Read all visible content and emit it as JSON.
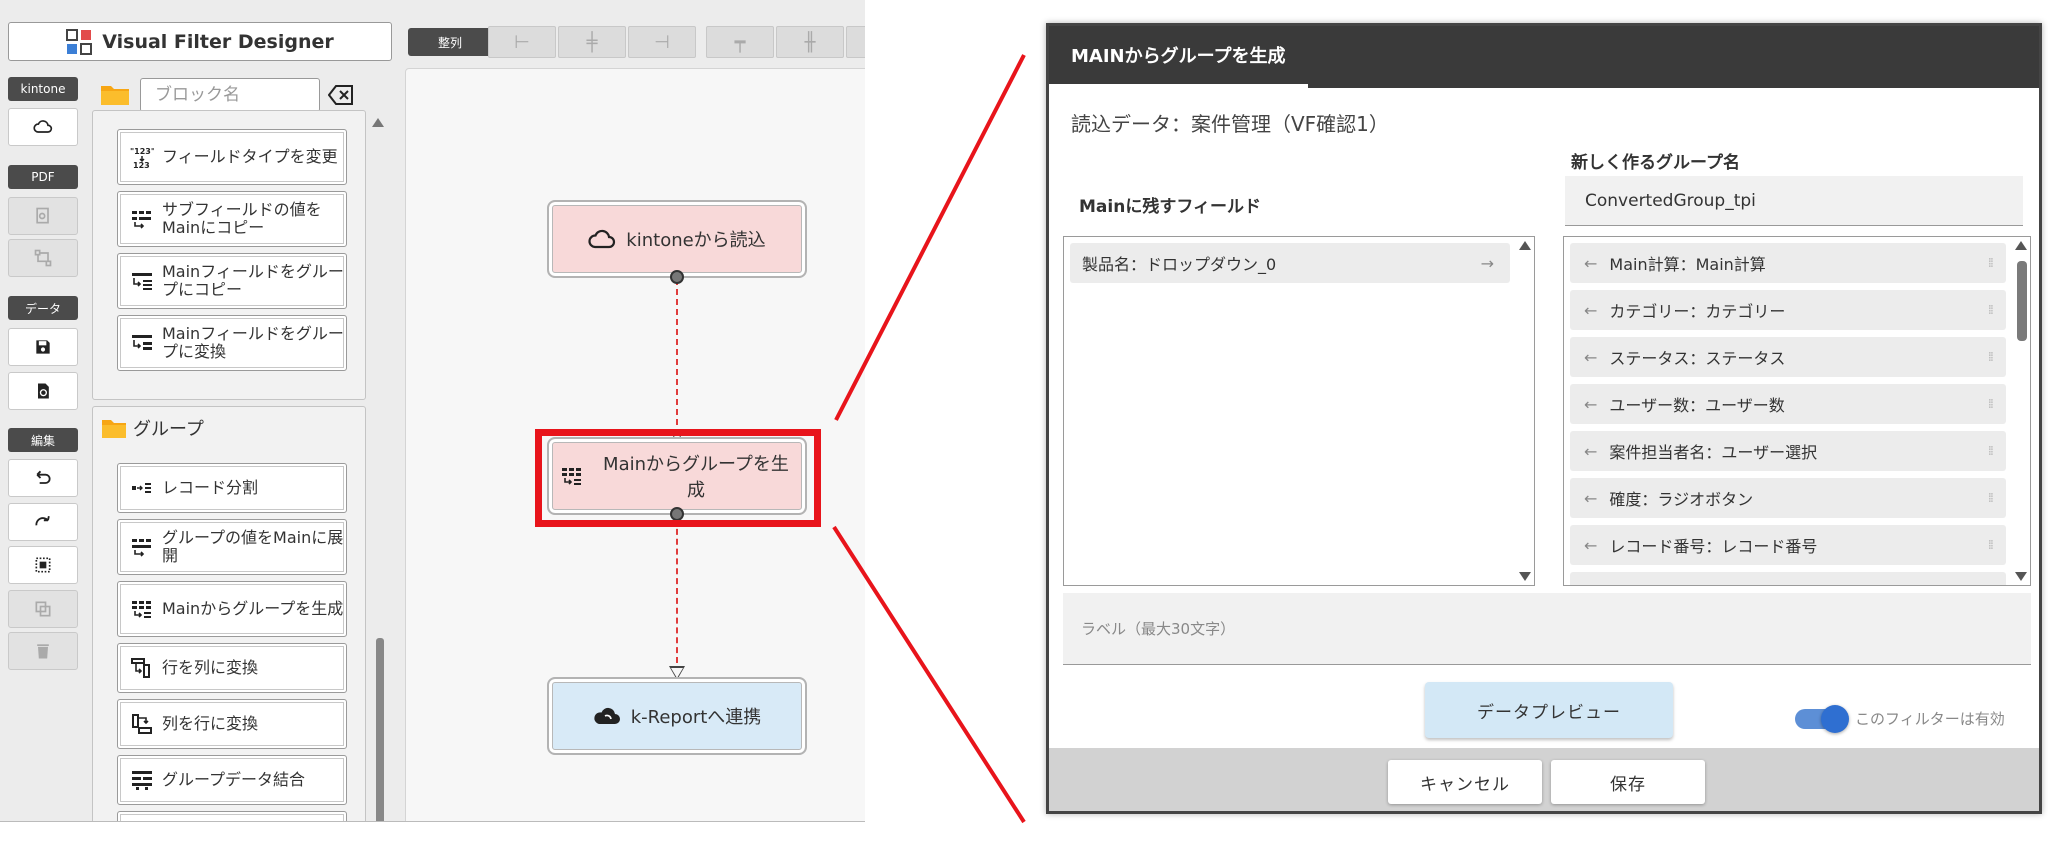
{
  "app": {
    "title": "Visual Filter Designer",
    "align_label": "整列",
    "search_placeholder": "ブロック名"
  },
  "sidebar": {
    "kintone_label": "kintone",
    "pdf_label": "PDF",
    "data_label": "データ",
    "edit_label": "編集"
  },
  "palette": {
    "blocks_top": [
      "フィールドタイプを変更",
      "サブフィールドの値をMainにコピー",
      "Mainフィールドをグループにコピー",
      "Mainフィールドをグループに変換"
    ],
    "group_title": "グループ",
    "blocks_group": [
      "レコード分割",
      "グループの値をMainに展開",
      "Mainからグループを生成",
      "行を列に変換",
      "列を行に変換",
      "グループデータ結合"
    ]
  },
  "canvas": {
    "nodes": [
      "kintoneから読込",
      "Mainからグループを生成",
      "k-Reportへ連携"
    ]
  },
  "dialog": {
    "title": "MAINからグループを生成",
    "read_data": "読込データ：案件管理（VF確認1）",
    "new_group_label": "新しく作るグループ名",
    "group_name_value": "ConvertedGroup_tpi",
    "main_fields_label": "Mainに残すフィールド",
    "left_items": [
      "製品名：ドロップダウン_0"
    ],
    "right_items": [
      "Main計算：Main計算",
      "カテゴリー：カテゴリー",
      "ステータス：ステータス",
      "ユーザー数：ユーザー数",
      "案件担当者名：ユーザー選択",
      "確度：ラジオボタン",
      "レコード番号：レコード番号"
    ],
    "label_placeholder": "ラベル（最大30文字）",
    "preview_button": "データプレビュー",
    "toggle_label": "このフィルターは有効",
    "cancel_button": "キャンセル",
    "save_button": "保存"
  },
  "colors": {
    "highlight": "#e8141b",
    "node_pink": "#f8d9d9",
    "node_blue": "#d8eaf7",
    "toggle": "#2f6fd1"
  }
}
